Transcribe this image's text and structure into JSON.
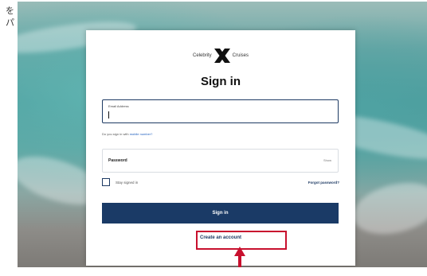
{
  "side_text": [
    "を",
    "パ"
  ],
  "brand": {
    "logo_left": "Celebrity",
    "logo_right": "Cruises"
  },
  "form": {
    "title": "Sign in",
    "email_label": "Email Address",
    "hint_prefix": "Do you sign in with",
    "hint_link": "mobile number?",
    "password_label": "Password",
    "show_label": "Show",
    "stay_signed_in": "Stay signed in",
    "forgot_password": "Forgot password?",
    "sign_in_button": "Sign in",
    "create_account": "Create an account"
  },
  "colors": {
    "primary": "#1a3a66",
    "highlight": "#c8102e"
  },
  "icons": {
    "logo_mark": "celebrity-x-logo-icon",
    "annotation": "arrow-up-icon"
  }
}
